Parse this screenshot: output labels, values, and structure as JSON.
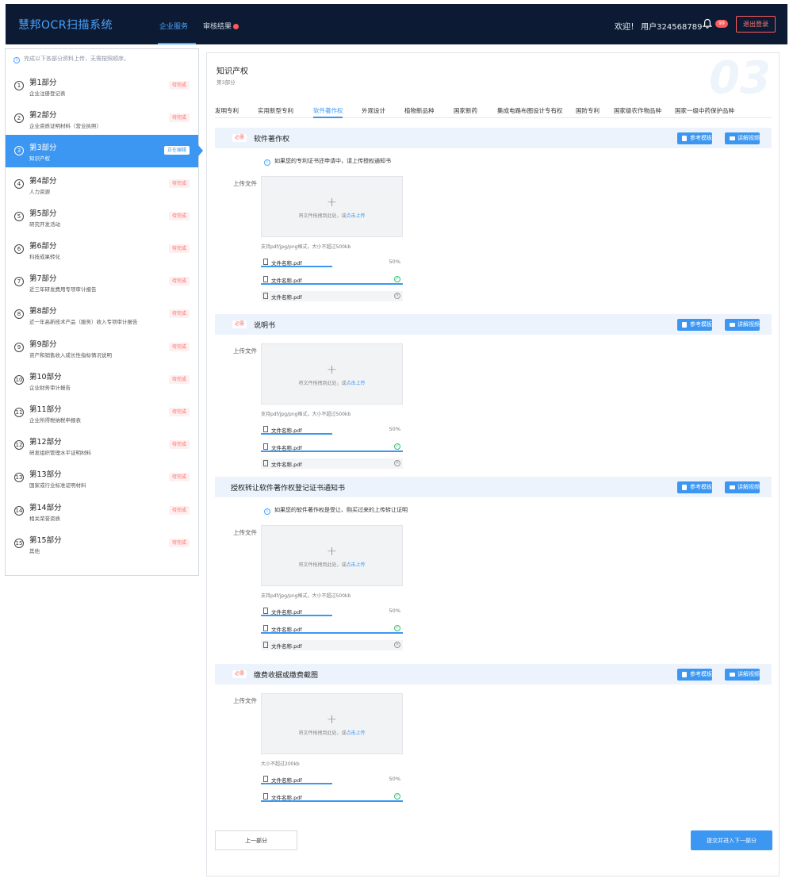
{
  "header": {
    "logo": "慧邦OCR扫描系统",
    "nav": [
      "企业服务",
      "审核结果"
    ],
    "welcome": "欢迎！ 用户324568789",
    "notifications": "99",
    "logout": "退出登录"
  },
  "sidebar": {
    "tip": "完成以下各部分资料上传，无需按照顺序。",
    "steps": [
      {
        "num": "1",
        "title": "第1部分",
        "sub": "企业注册登记表",
        "status": "待完成"
      },
      {
        "num": "2",
        "title": "第2部分",
        "sub": "企业资质证明材料（营业执照）",
        "status": "待完成"
      },
      {
        "num": "3",
        "title": "第3部分",
        "sub": "知识产权",
        "status": "正在编辑"
      },
      {
        "num": "4",
        "title": "第4部分",
        "sub": "人力资源",
        "status": "待完成"
      },
      {
        "num": "5",
        "title": "第5部分",
        "sub": "研究开发活动",
        "status": "待完成"
      },
      {
        "num": "6",
        "title": "第6部分",
        "sub": "科技成果转化",
        "status": "待完成"
      },
      {
        "num": "7",
        "title": "第7部分",
        "sub": "近三年研发费用专项审计报告",
        "status": "待完成"
      },
      {
        "num": "8",
        "title": "第8部分",
        "sub": "近一年高新技术产品（服务）收入专项审计报告",
        "status": "待完成"
      },
      {
        "num": "9",
        "title": "第9部分",
        "sub": "资产和销售收入成长性指标情况说明",
        "status": "待完成"
      },
      {
        "num": "10",
        "title": "第10部分",
        "sub": "企业财务审计报告",
        "status": "待完成"
      },
      {
        "num": "11",
        "title": "第11部分",
        "sub": "企业所得税纳税申报表",
        "status": "待完成"
      },
      {
        "num": "12",
        "title": "第12部分",
        "sub": "研发组织管理水平证明材料",
        "status": "待完成"
      },
      {
        "num": "13",
        "title": "第13部分",
        "sub": "国家或行业标准证明材料",
        "status": "待完成"
      },
      {
        "num": "14",
        "title": "第14部分",
        "sub": "相关荣誉资质",
        "status": "待完成"
      },
      {
        "num": "15",
        "title": "第15部分",
        "sub": "其他",
        "status": "待完成"
      }
    ]
  },
  "main": {
    "title": "知识产权",
    "sub": "第3部分",
    "watermark": "03",
    "tabs": [
      "发明专利",
      "实用新型专利",
      "软件著作权",
      "外观设计",
      "植物新品种",
      "国家新药",
      "集成电路布图设计专有权",
      "国防专利",
      "国家级农作物品种",
      "国家一级中药保护品种"
    ],
    "required": "必需",
    "ref_btn": "参考模板",
    "video_btn": "讲解视频",
    "upload_label": "上传文件",
    "drop_text": "将文件拖拽到此处，或",
    "drop_link": "点击上传",
    "sections": [
      {
        "title": "软件著作权",
        "hint": "如果您的专利证书还申请中，请上传授权通知书",
        "formats": "支持pdf/jpg/png格式，大小不超过500kb",
        "files": [
          {
            "name": "文件名称.pdf",
            "pct": "50%",
            "progress": 0.5
          },
          {
            "name": "文件名称.pdf",
            "state": "done"
          },
          {
            "name": "文件名称.pdf",
            "state": "error"
          }
        ]
      },
      {
        "title": "说明书",
        "formats": "支持pdf/jpg/png格式，大小不超过500kb",
        "files": [
          {
            "name": "文件名称.pdf",
            "pct": "50%",
            "progress": 0.5
          },
          {
            "name": "文件名称.pdf",
            "state": "done"
          },
          {
            "name": "文件名称.pdf",
            "state": "error"
          }
        ]
      },
      {
        "title": "授权转让软件著作权登记证书通知书",
        "hint": "如果您的软件著作权是受让、购买过来的上传转让证明",
        "formats": "支持pdf/jpg/png格式，大小不超过500kb",
        "files": [
          {
            "name": "文件名称.pdf",
            "pct": "50%",
            "progress": 0.5
          },
          {
            "name": "文件名称.pdf",
            "state": "done"
          },
          {
            "name": "文件名称.pdf",
            "state": "error"
          }
        ]
      },
      {
        "title": "缴费收据或缴费截图",
        "formats": "大小不超过200kb",
        "files": [
          {
            "name": "文件名称.pdf",
            "pct": "50%",
            "progress": 0.5
          },
          {
            "name": "文件名称.pdf",
            "state": "done"
          }
        ]
      }
    ],
    "prev": "上一部分",
    "next": "提交并进入下一部分"
  }
}
